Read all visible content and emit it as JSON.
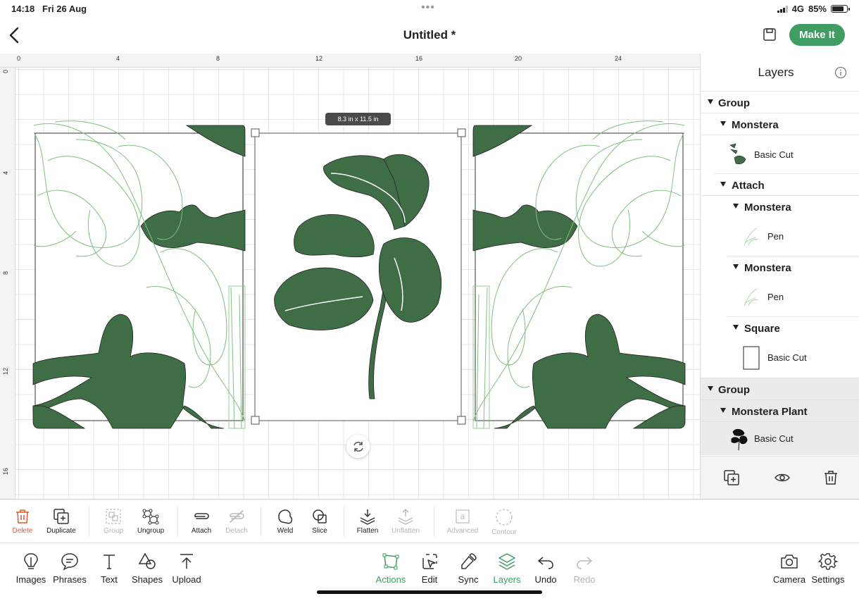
{
  "status_bar": {
    "time": "14:18",
    "date": "Fri 26 Aug",
    "network": "4G",
    "battery": "85%",
    "battery_level": 0.85
  },
  "header": {
    "title": "Untitled *",
    "make_it_label": "Make It"
  },
  "canvas": {
    "ruler_x_labels": [
      "0",
      "4",
      "8",
      "12",
      "16",
      "20",
      "24"
    ],
    "ruler_y_labels": [
      "0",
      "4",
      "8",
      "12",
      "16"
    ],
    "selection_size": "8.3 in x 11.5 in",
    "colors": {
      "leaf_fill": "#3f6d45",
      "line_art": "#7fbf7f",
      "selection": "#555555"
    }
  },
  "layers": {
    "title": "Layers",
    "tree": {
      "group1": "Group",
      "monstera1": "Monstera",
      "monstera1_item": "Basic Cut",
      "attach": "Attach",
      "monstera2": "Monstera",
      "monstera2_item": "Pen",
      "monstera3": "Monstera",
      "monstera3_item": "Pen",
      "square": "Square",
      "square_item": "Basic Cut",
      "group2": "Group",
      "monstera_plant": "Monstera Plant",
      "monstera_plant_item": "Basic Cut"
    }
  },
  "actions": {
    "delete": "Delete",
    "duplicate": "Duplicate",
    "group": "Group",
    "ungroup": "Ungroup",
    "attach": "Attach",
    "detach": "Detach",
    "weld": "Weld",
    "slice": "Slice",
    "flatten": "Flatten",
    "unflatten": "Unflatten",
    "advanced": "Advanced",
    "contour": "Contour"
  },
  "tabs": {
    "images": "Images",
    "phrases": "Phrases",
    "text": "Text",
    "shapes": "Shapes",
    "upload": "Upload",
    "actions": "Actions",
    "edit": "Edit",
    "sync": "Sync",
    "layers": "Layers",
    "undo": "Undo",
    "redo": "Redo",
    "camera": "Camera",
    "settings": "Settings"
  }
}
